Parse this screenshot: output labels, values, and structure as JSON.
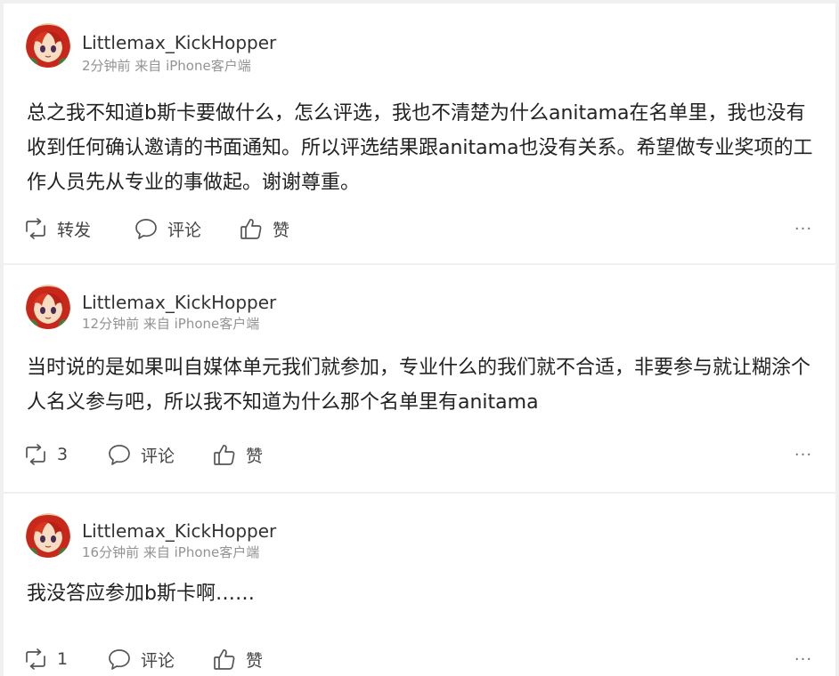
{
  "colors": {
    "background": "#f0f0f0",
    "card": "#ffffff",
    "username": "#333333",
    "meta": "#939393",
    "body_text": "#222222",
    "action_text": "#444444"
  },
  "posts": [
    {
      "username": "Littlemax_KickHopper",
      "meta": "2分钟前 来自 iPhone客户端",
      "content": "总之我不知道b斯卡要做什么，怎么评选，我也不清楚为什么anitama在名单里，我也没有收到任何确认邀请的书面通知。所以评选结果跟anitama也没有关系。希望做专业奖项的工作人员先从专业的事做起。谢谢尊重。",
      "repost_label": "转发",
      "comment_label": "评论",
      "like_label": "赞",
      "more_label": "···"
    },
    {
      "username": "Littlemax_KickHopper",
      "meta": "12分钟前 来自 iPhone客户端",
      "content": "当时说的是如果叫自媒体单元我们就参加，专业什么的我们就不合适，非要参与就让糊涂个人名义参与吧，所以我不知道为什么那个名单里有anitama",
      "repost_label": "3",
      "comment_label": "评论",
      "like_label": "赞",
      "more_label": "···"
    },
    {
      "username": "Littlemax_KickHopper",
      "meta": "16分钟前 来自 iPhone客户端",
      "content": "我没答应参加b斯卡啊……",
      "repost_label": "1",
      "comment_label": "评论",
      "like_label": "赞",
      "more_label": "···"
    }
  ],
  "icons": {
    "avatar": "avatar-red-hair-character",
    "repost": "repost-icon",
    "comment": "comment-icon",
    "like": "thumbs-up-icon",
    "more": "more-icon"
  }
}
